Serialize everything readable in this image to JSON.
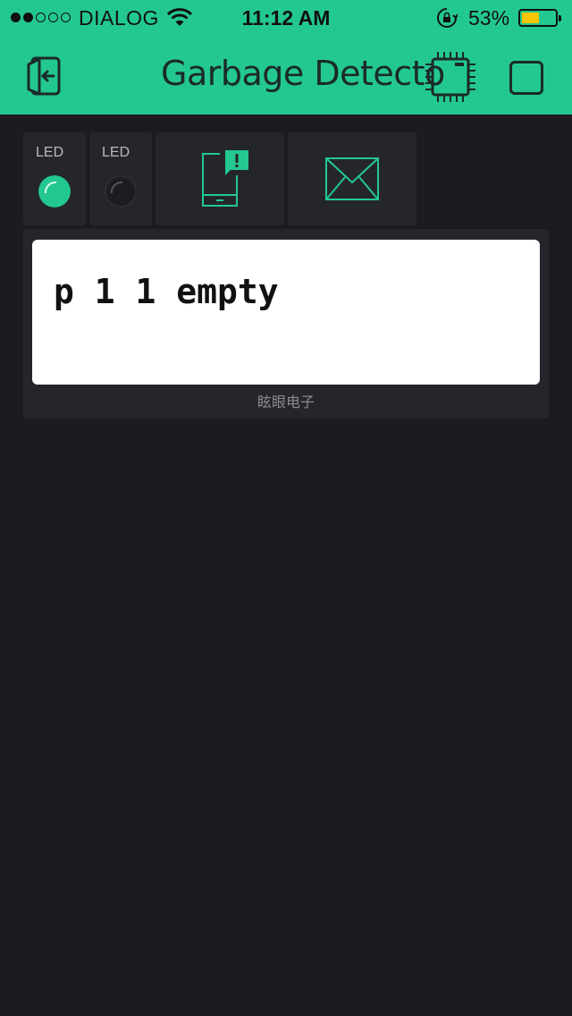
{
  "status_bar": {
    "carrier": "DIALOG",
    "time": "11:12 AM",
    "battery_percent": "53%",
    "battery_level": 0.53,
    "signal_bars_filled": 2,
    "signal_bars_total": 5
  },
  "header": {
    "title": "Garbage Detecto",
    "icons": [
      "exit-icon",
      "chip-icon",
      "stop-icon"
    ]
  },
  "widgets": {
    "led1": {
      "label": "LED",
      "state": "on",
      "color": "#23c890"
    },
    "led2": {
      "label": "LED",
      "state": "off"
    },
    "notification": {
      "icon": "phone-notification-icon",
      "color": "#23c890"
    },
    "email": {
      "icon": "envelope-icon",
      "color": "#23c890"
    }
  },
  "lcd": {
    "line1": "p 1 1 empty",
    "line2": "",
    "name": "眩眼电子"
  },
  "colors": {
    "accent": "#23c890",
    "background": "#1b1c21",
    "tile": "#25262c"
  }
}
